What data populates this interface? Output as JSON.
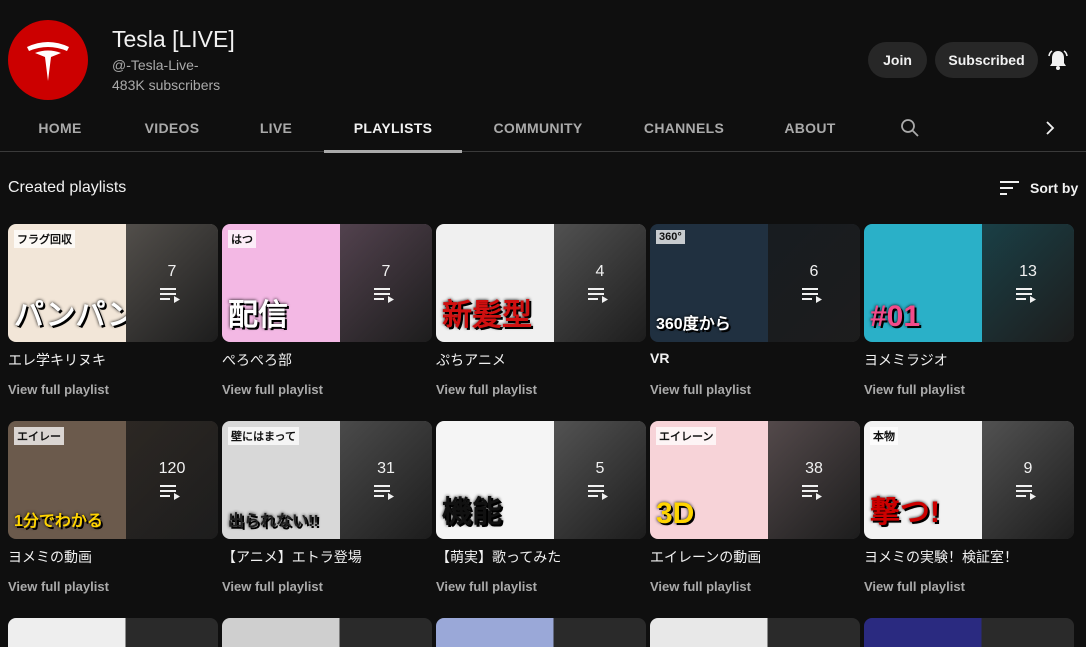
{
  "channel": {
    "name": "Tesla [LIVE]",
    "handle": "@-Tesla-Live-",
    "subscribers": "483K subscribers",
    "avatar_color": "#cc0000"
  },
  "actions": {
    "join_label": "Join",
    "subscribed_label": "Subscribed",
    "bell_icon": "bell-icon"
  },
  "tabs": [
    {
      "label": "HOME",
      "active": false
    },
    {
      "label": "VIDEOS",
      "active": false
    },
    {
      "label": "LIVE",
      "active": false
    },
    {
      "label": "PLAYLISTS",
      "active": true
    },
    {
      "label": "COMMUNITY",
      "active": false
    },
    {
      "label": "CHANNELS",
      "active": false
    },
    {
      "label": "ABOUT",
      "active": false
    }
  ],
  "section": {
    "title": "Created playlists",
    "sort_label": "Sort by"
  },
  "playlists": [
    {
      "title": "エレ学キリヌキ",
      "count": "7",
      "link": "View full playlist",
      "art_text": "パンパン",
      "badge": "フラグ回収",
      "bg": "#f2e6d8",
      "fg": "#ffffff"
    },
    {
      "title": "ぺろぺろ部",
      "count": "7",
      "link": "View full playlist",
      "art_text": "配信",
      "badge": "はつ",
      "bg": "#f3b8e4",
      "fg": "#ffffff"
    },
    {
      "title": "ぷちアニメ",
      "count": "4",
      "link": "View full playlist",
      "art_text": "新髪型",
      "badge": "",
      "bg": "#f0f0f0",
      "fg": "#d01010"
    },
    {
      "title": "VR",
      "count": "6",
      "link": "View full playlist",
      "art_text": "360度から",
      "badge": "360°",
      "bg": "#203040",
      "fg": "#ffffff"
    },
    {
      "title": "ヨメミラジオ",
      "count": "13",
      "link": "View full playlist",
      "art_text": "#01",
      "badge": "",
      "bg": "#2ab0c8",
      "fg": "#f24b8a"
    },
    {
      "title": "ヨメミの動画",
      "count": "120",
      "link": "View full playlist",
      "art_text": "1分でわかる",
      "badge": "エイレー",
      "bg": "#6b5a4c",
      "fg": "#ffd400"
    },
    {
      "title": "【アニメ】エトラ登場",
      "count": "31",
      "link": "View full playlist",
      "art_text": "出られない!!",
      "badge": "壁にはまって",
      "bg": "#d8d8d8",
      "fg": "#222222"
    },
    {
      "title": "【萌実】歌ってみた",
      "count": "5",
      "link": "View full playlist",
      "art_text": "機能",
      "badge": "",
      "bg": "#f5f5f5",
      "fg": "#111111"
    },
    {
      "title": "エイレーンの動画",
      "count": "38",
      "link": "View full playlist",
      "art_text": "3D",
      "badge": "エイレーン",
      "bg": "#f7d3d8",
      "fg": "#ffd400"
    },
    {
      "title": "ヨメミの実験！検証室！",
      "count": "9",
      "link": "View full playlist",
      "art_text": "撃つ!",
      "badge": "本物",
      "bg": "#f2f2f2",
      "fg": "#cc0000"
    }
  ],
  "partial_row": [
    {
      "bg": "#eeeeee"
    },
    {
      "bg": "#cfcfcf"
    },
    {
      "bg": "#9aa8d8"
    },
    {
      "bg": "#e8e8e8"
    },
    {
      "bg": "#2a2a80"
    }
  ]
}
